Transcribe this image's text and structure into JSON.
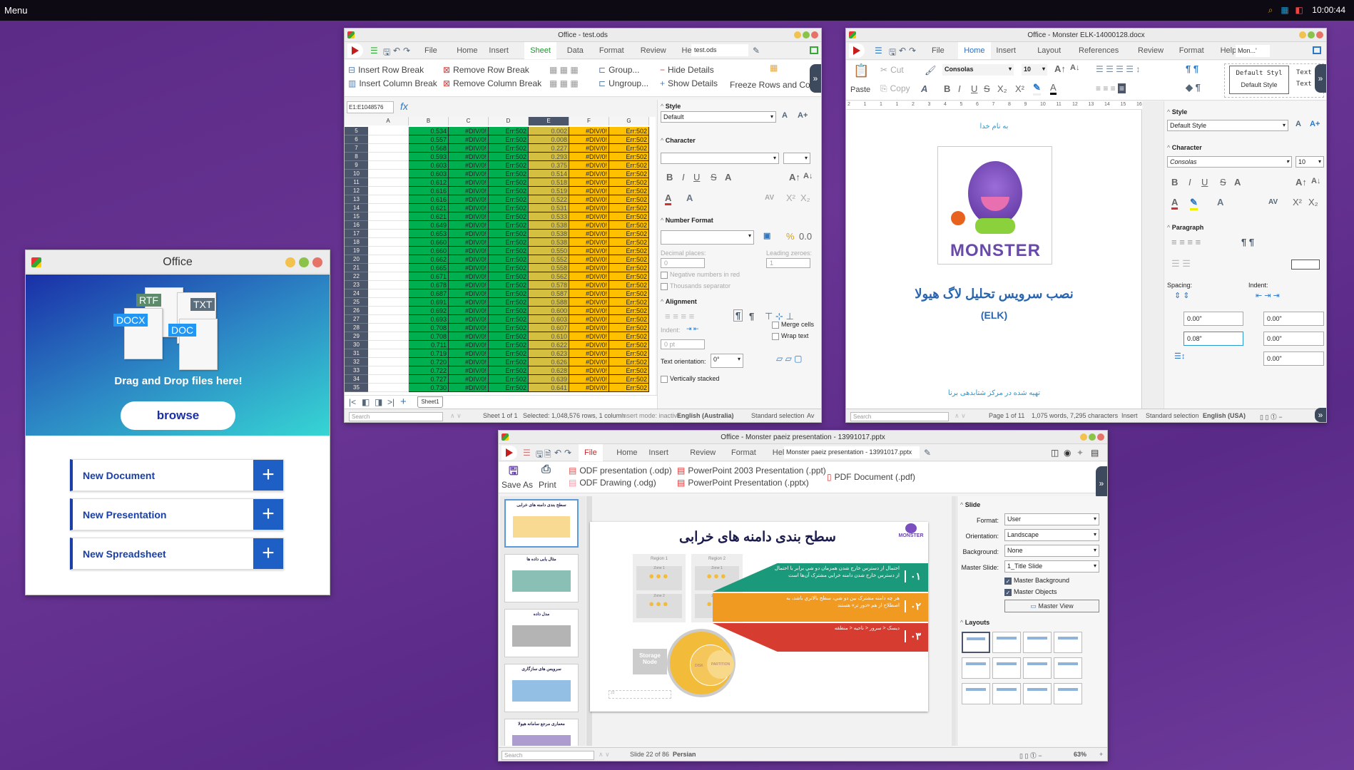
{
  "topbar": {
    "menu": "Menu",
    "clock": "10:00:44",
    "tray_icons": [
      "search-icon",
      "network-icon",
      "office-icon"
    ]
  },
  "launcher": {
    "title": "Office",
    "file_tags": [
      "RTF",
      "TXT",
      "DOCX",
      "DOC"
    ],
    "drop_text": "Drag and Drop files here!",
    "browse": "browse",
    "buttons": [
      {
        "label": "New Document"
      },
      {
        "label": "New Presentation"
      },
      {
        "label": "New Spreadsheet"
      }
    ],
    "gradient": [
      "#1a2fa8",
      "#36d6d4"
    ]
  },
  "calc": {
    "title": "Office - test.ods",
    "tabs": [
      "File",
      "Home",
      "Insert",
      "Sheet",
      "Data",
      "Format",
      "Review",
      "Help"
    ],
    "active_tab": "Sheet",
    "filename": "test.ods",
    "ribbon": {
      "insert_row_break": "Insert Row Break",
      "insert_col_break": "Insert Column Break",
      "remove_row_break": "Remove Row Break",
      "remove_col_break": "Remove Column Break",
      "group": "Group...",
      "ungroup": "Ungroup...",
      "hide_details": "Hide Details",
      "show_details": "Show Details",
      "freeze": "Freeze Rows and Columns"
    },
    "name_box": "E1:E1048576",
    "fx": "fx",
    "columns": [
      "A",
      "B",
      "C",
      "D",
      "E",
      "F",
      "G"
    ],
    "selected_column": "E",
    "rows": [
      {
        "n": 5,
        "b": "0.534",
        "e": "0.002"
      },
      {
        "n": 6,
        "b": "0.557",
        "e": "0.008"
      },
      {
        "n": 7,
        "b": "0.568",
        "e": "0.227"
      },
      {
        "n": 8,
        "b": "0.593",
        "e": "0.293"
      },
      {
        "n": 9,
        "b": "0.603",
        "e": "0.375"
      },
      {
        "n": 10,
        "b": "0.603",
        "e": "0.514"
      },
      {
        "n": 11,
        "b": "0.612",
        "e": "0.518"
      },
      {
        "n": 12,
        "b": "0.616",
        "e": "0.519"
      },
      {
        "n": 13,
        "b": "0.616",
        "e": "0.522"
      },
      {
        "n": 14,
        "b": "0.621",
        "e": "0.531"
      },
      {
        "n": 15,
        "b": "0.621",
        "e": "0.533"
      },
      {
        "n": 16,
        "b": "0.649",
        "e": "0.538"
      },
      {
        "n": 17,
        "b": "0.653",
        "e": "0.538"
      },
      {
        "n": 18,
        "b": "0.660",
        "e": "0.538"
      },
      {
        "n": 19,
        "b": "0.660",
        "e": "0.550"
      },
      {
        "n": 20,
        "b": "0.662",
        "e": "0.552"
      },
      {
        "n": 21,
        "b": "0.665",
        "e": "0.558"
      },
      {
        "n": 22,
        "b": "0.671",
        "e": "0.562"
      },
      {
        "n": 23,
        "b": "0.678",
        "e": "0.578"
      },
      {
        "n": 24,
        "b": "0.687",
        "e": "0.587"
      },
      {
        "n": 25,
        "b": "0.691",
        "e": "0.588"
      },
      {
        "n": 26,
        "b": "0.692",
        "e": "0.600"
      },
      {
        "n": 27,
        "b": "0.693",
        "e": "0.603"
      },
      {
        "n": 28,
        "b": "0.708",
        "e": "0.607"
      },
      {
        "n": 29,
        "b": "0.708",
        "e": "0.610"
      },
      {
        "n": 30,
        "b": "0.711",
        "e": "0.622"
      },
      {
        "n": 31,
        "b": "0.719",
        "e": "0.623"
      },
      {
        "n": 32,
        "b": "0.720",
        "e": "0.626"
      },
      {
        "n": 33,
        "b": "0.722",
        "e": "0.628"
      },
      {
        "n": 34,
        "b": "0.727",
        "e": "0.639"
      },
      {
        "n": 35,
        "b": "0.730",
        "e": "0.641"
      }
    ],
    "col_c_value": "#DIV/0!",
    "col_d_value": "Err:502",
    "col_f_value": "#DIV/0!",
    "col_g_value": "Err:502",
    "colors": {
      "green": "#00b050",
      "olive": "#d4bf40",
      "orange": "#ffc000"
    },
    "sheet_tab": "Sheet1",
    "sidebar": {
      "style": "Style",
      "style_value": "Default",
      "character": "Character",
      "number_format": "Number Format",
      "decimal_places": "Decimal places:",
      "decimal_value": "0",
      "leading_zeroes": "Leading zeroes:",
      "leading_value": "1",
      "negative_red": "Negative numbers in red",
      "thousands": "Thousands separator",
      "alignment": "Alignment",
      "indent": "Indent:",
      "indent_value": "0 pt",
      "merge": "Merge cells",
      "wrap": "Wrap text",
      "orientation": "Text orientation:",
      "orientation_value": "0°",
      "vertically_stacked": "Vertically stacked"
    },
    "status": {
      "search": "Search",
      "sheet": "Sheet 1 of 1",
      "selected": "Selected: 1,048,576 rows, 1 column",
      "insert_mode": "Insert mode: inactive",
      "language": "English (Australia)",
      "selection": "Standard selection",
      "avg": "Av"
    }
  },
  "writer": {
    "title": "Office - Monster ELK-14000128.docx",
    "tabs": [
      "File",
      "Home",
      "Insert",
      "Layout",
      "References",
      "Review",
      "Format",
      "Help"
    ],
    "active_tab": "Home",
    "filename": "Mon...'",
    "ribbon": {
      "paste": "Paste",
      "cut": "Cut",
      "copy": "Copy",
      "font": "Consolas",
      "size": "10",
      "style_preview": "Default Styl",
      "style_name": "Default Style",
      "style2_preview": "Text B",
      "style2_name": "Text"
    },
    "ruler": [
      "2",
      "1",
      "1",
      "1",
      "2",
      "3",
      "4",
      "5",
      "6",
      "7",
      "8",
      "9",
      "10",
      "11",
      "12",
      "13",
      "14",
      "15",
      "16"
    ],
    "doc": {
      "header": "به نام خدا",
      "logo_text": "MONSTER",
      "title": "نصب سرویس تحلیل لاگ هیولا",
      "subtitle": "(ELK)",
      "footer": "تهیه شده در مرکز شتابدهی برنا"
    },
    "sidebar": {
      "style": "Style",
      "style_value": "Default Style",
      "character": "Character",
      "font": "Consolas",
      "size": "10",
      "paragraph": "Paragraph",
      "spacing": "Spacing:",
      "indent": "Indent:",
      "above": "0.00\"",
      "below": "0.08\"",
      "indent_before": "0.00\"",
      "indent_after": "0.00\"",
      "first_line": "0.00\""
    },
    "status": {
      "search": "Search",
      "page": "Page 1 of 11",
      "words": "1,075 words, 7,295 characters",
      "mode": "Insert",
      "selection": "Standard selection",
      "language": "English (USA)"
    }
  },
  "impress": {
    "title": "Office - Monster paeiz presentation - 13991017.pptx",
    "tabs": [
      "File",
      "Home",
      "Insert",
      "Review",
      "Format",
      "Help"
    ],
    "active_tab": "File",
    "filename": "Monster paeiz presentation - 13991017.pptx",
    "ribbon": {
      "save_as": "Save As",
      "print": "Print",
      "odp": "ODF presentation (.odp)",
      "odg": "ODF Drawing (.odg)",
      "ppt": "PowerPoint 2003 Presentation (.ppt)",
      "pptx": "PowerPoint Presentation (.pptx)",
      "pdf": "PDF Document (.pdf)"
    },
    "thumbs": [
      "سطح بندی دامنه های خرابی",
      "مثال یابی داده ها",
      "مدل داده",
      "سرویس های سازگاری",
      "معماری مرجع سامانه هیولا"
    ],
    "slide": {
      "title": "سطح بندی دامنه های خرابی",
      "logo_text": "MONSTER",
      "regions": [
        "Region 1",
        "Region 2"
      ],
      "zones": [
        "Zone 1",
        "Zone 2"
      ],
      "storage_node": "Storage Node",
      "disk": "DISK",
      "partition": "PARTITION",
      "items": [
        {
          "num": "۰۱",
          "text": "احتمال از دسترس خارج شدن همزمان دو شي برابر با احتمال از دسترس خارج شدن دامنه خرابي مشترک آن‌ها است",
          "color": "#1a9a7a"
        },
        {
          "num": "۰۲",
          "text": "هر چه دامنه مشترک بين دو شي، سطح بالاتري باشد، به اصطلاح از هم «دور تر» هستند",
          "color": "#f09a22"
        },
        {
          "num": "۰۳",
          "text": "ديسک < سرور < ناحيه < منطقه",
          "color": "#d63c2f"
        }
      ],
      "page_number": "22"
    },
    "sidebar": {
      "slide": "Slide",
      "format_label": "Format:",
      "format": "User",
      "orientation_label": "Orientation:",
      "orientation": "Landscape",
      "background_label": "Background:",
      "background": "None",
      "master_label": "Master Slide:",
      "master": "1_Title Slide",
      "master_bg": "Master Background",
      "master_obj": "Master Objects",
      "master_view": "Master View",
      "layouts": "Layouts"
    },
    "status": {
      "search": "Search",
      "slide": "Slide 22 of 86",
      "language": "Persian",
      "zoom": "63%"
    }
  }
}
